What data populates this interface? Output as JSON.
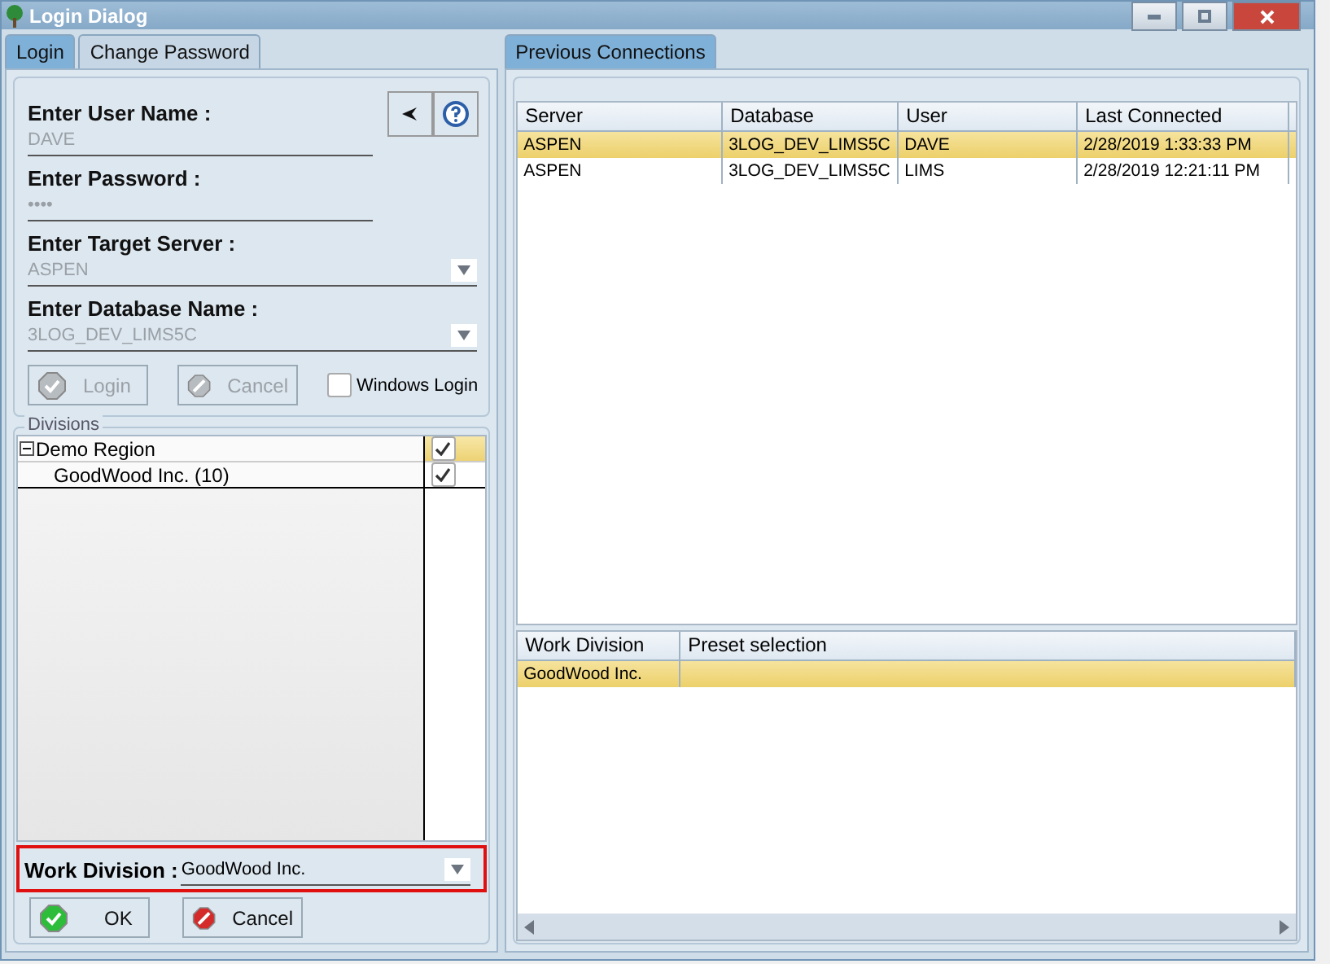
{
  "window": {
    "title": "Login Dialog"
  },
  "left_tabs": [
    {
      "label": "Login",
      "selected": true
    },
    {
      "label": "Change Password",
      "selected": false
    }
  ],
  "login_form": {
    "fields": [
      {
        "kind": "text",
        "label": "Enter User Name :",
        "value": "DAVE",
        "disabled": true
      },
      {
        "kind": "text",
        "label": "Enter Password :",
        "value": "••••",
        "disabled": true
      },
      {
        "kind": "dropdown",
        "label": "Enter Target Server :",
        "value": "ASPEN",
        "disabled": true
      },
      {
        "kind": "dropdown",
        "label": "Enter Database Name :",
        "value": "3LOG_DEV_LIMS5C",
        "disabled": true
      }
    ],
    "buttons": [
      {
        "label": "Login",
        "disabled": true
      },
      {
        "label": "Cancel",
        "disabled": true
      }
    ],
    "windows_login": {
      "label": "Windows Login",
      "checked": false
    }
  },
  "divisions": {
    "title": "Divisions",
    "tree": [
      {
        "label": "Demo Region",
        "expanded": true,
        "checked": true,
        "selected": true,
        "children": [
          {
            "label": "GoodWood Inc. (10)",
            "checked": true,
            "selected": false
          }
        ]
      }
    ]
  },
  "work_division": {
    "label": "Work Division :",
    "value": "GoodWood Inc.",
    "highlighted": true
  },
  "dialog_buttons": [
    {
      "label": "OK",
      "kind": "ok"
    },
    {
      "label": "Cancel",
      "kind": "cancel"
    }
  ],
  "right_tabs": [
    {
      "label": "Previous Connections",
      "selected": true
    }
  ],
  "connections": {
    "columns": [
      "Server",
      "Database",
      "User",
      "Last Connected"
    ],
    "rows": [
      {
        "cells": [
          "ASPEN",
          "3LOG_DEV_LIMS5C",
          "DAVE",
          "2/28/2019 1:33:33 PM"
        ],
        "selected": true
      },
      {
        "cells": [
          "ASPEN",
          "3LOG_DEV_LIMS5C",
          "LIMS",
          "2/28/2019 12:21:11 PM"
        ],
        "selected": false
      }
    ]
  },
  "presets": {
    "columns": [
      "Work Division",
      "Preset selection"
    ],
    "rows": [
      {
        "cells": [
          "GoodWood Inc."
        ],
        "selected": true
      }
    ]
  }
}
